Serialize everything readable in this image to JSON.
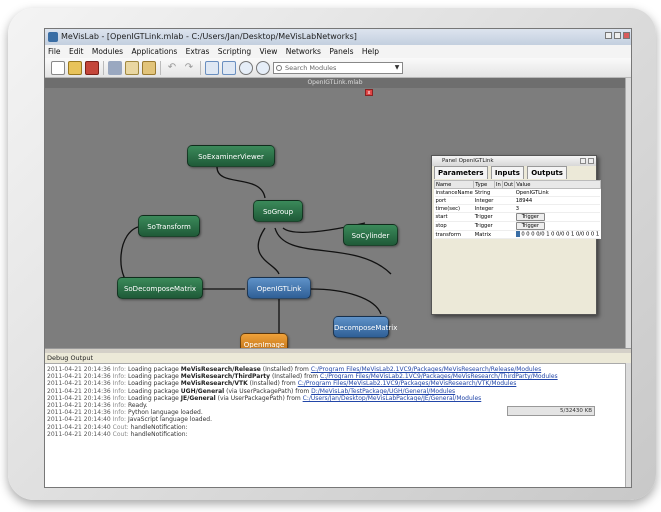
{
  "window": {
    "title": "MeVisLab - [OpenIGTLink.mlab - C:/Users/Jan/Desktop/MeVisLabNetworks]"
  },
  "menu": [
    "File",
    "Edit",
    "Modules",
    "Applications",
    "Extras",
    "Scripting",
    "View",
    "Networks",
    "Panels",
    "Help"
  ],
  "search": {
    "placeholder": "Search Modules"
  },
  "canvas": {
    "tab_label": "OpenIGTLink.mlab"
  },
  "nodes": {
    "so_examiner_viewer": "SoExaminerViewer",
    "so_group": "SoGroup",
    "so_transform": "SoTransform",
    "so_cylinder": "SoCylinder",
    "so_decompose_matrix": "SoDecomposeMatrix",
    "open_igt_link": "OpenIGTLink",
    "decompose_matrix": "DecomposeMatrix",
    "open_image": "OpenImage"
  },
  "panel": {
    "title": "Panel OpenIGTLink",
    "tabs": [
      "Parameters",
      "Inputs",
      "Outputs"
    ],
    "columns": [
      "Name",
      "Type",
      "In",
      "Out",
      "Value"
    ],
    "rows": [
      {
        "name": "instanceName",
        "type": "String",
        "value": "OpenIGTLink"
      },
      {
        "name": "port",
        "type": "Integer",
        "value": "18944"
      },
      {
        "name": "time(sec)",
        "type": "Integer",
        "value": "3"
      },
      {
        "name": "start",
        "type": "Trigger",
        "value": "Trigger"
      },
      {
        "name": "stop",
        "type": "Trigger",
        "value": "Trigger"
      },
      {
        "name": "transform",
        "type": "Matrix",
        "value": "0 0 0 0/0 1 0 0/0 0 1 0/0 0 0 1"
      }
    ]
  },
  "debug": {
    "title": "Debug Output",
    "status_memory": "5/32430 KB",
    "lines": [
      {
        "ts": "2011-04-21 20:14:36",
        "level": "Info:",
        "text": "Loading package ",
        "pkg": "MeVisResearch/Release",
        "note": " (Installed) from ",
        "link": "C:/Program Files/MeVisLab2.1VC9/Packages/MeVisResearch/Release/Modules"
      },
      {
        "ts": "2011-04-21 20:14:36",
        "level": "Info:",
        "text": "Loading package ",
        "pkg": "MeVisResearch/ThirdParty",
        "note": " (Installed) from ",
        "link": "C:/Program Files/MeVisLab2.1VC9/Packages/MeVisResearch/ThirdParty/Modules"
      },
      {
        "ts": "2011-04-21 20:14:36",
        "level": "Info:",
        "text": "Loading package ",
        "pkg": "MeVisResearch/VTK",
        "note": " (Installed) from ",
        "link": "C:/Program Files/MeVisLab2.1VC9/Packages/MeVisResearch/VTK/Modules"
      },
      {
        "ts": "2011-04-21 20:14:36",
        "level": "Info:",
        "text": "Loading package ",
        "pkg": "UGH/General",
        "note": " (via UserPackagePath) from ",
        "link": "D:/MeVisLab/TestPackage/UGH/General/Modules"
      },
      {
        "ts": "2011-04-21 20:14:36",
        "level": "Info:",
        "text": "Loading package ",
        "pkg": "JE/General",
        "note": " (via UserPackagePath) from ",
        "link": "C:/Users/Jan/Desktop/MeVisLabPackage/JE/General/Modules"
      },
      {
        "ts": "2011-04-21 20:14:36",
        "level": "Info:",
        "text": "Ready.",
        "pkg": "",
        "note": "",
        "link": ""
      },
      {
        "ts": "2011-04-21 20:14:36",
        "level": "Info:",
        "text": "Python language loaded.",
        "pkg": "",
        "note": "",
        "link": ""
      },
      {
        "ts": "2011-04-21 20:14:40",
        "level": "Info:",
        "text": "JavaScript language loaded.",
        "pkg": "",
        "note": "",
        "link": ""
      },
      {
        "ts": "2011-04-21 20:14:40",
        "level": "Cout:",
        "text": "handleNotification:",
        "pkg": "",
        "note": "",
        "link": ""
      },
      {
        "ts": "2011-04-21 20:14:40",
        "level": "Cout:",
        "text": "handleNotification:",
        "pkg": "",
        "note": "",
        "link": ""
      }
    ]
  }
}
